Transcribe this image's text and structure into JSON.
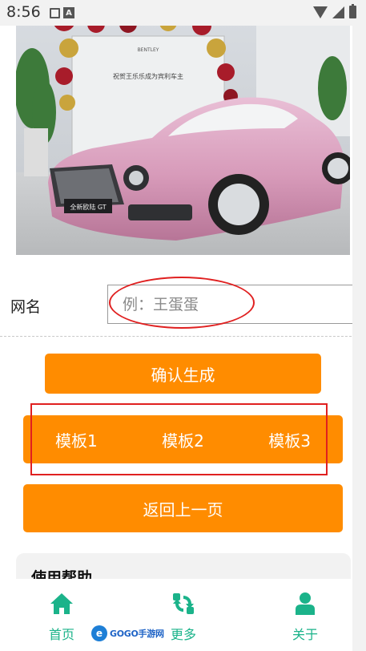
{
  "status_bar": {
    "time": "8:56"
  },
  "banner": {
    "car_plate": "全新欧陆 GT",
    "sign_text": "祝贺王乐乐成为宾利车主",
    "brand": "BENTLEY"
  },
  "form": {
    "label": "网名",
    "placeholder": "例：王蛋蛋"
  },
  "buttons": {
    "confirm": "确认生成",
    "templates": [
      "模板1",
      "模板2",
      "模板3"
    ],
    "back": "返回上一页"
  },
  "help": {
    "title": "使用帮助"
  },
  "nav": {
    "items": [
      {
        "label": "首页",
        "icon": "home-icon"
      },
      {
        "label": "更多",
        "icon": "refresh-icon"
      },
      {
        "label": "关于",
        "icon": "user-icon"
      }
    ]
  },
  "watermark": {
    "text": "GOGO手游网"
  },
  "colors": {
    "accent": "#ff8c00",
    "nav": "#1bb38a",
    "annotation": "#e02020"
  }
}
